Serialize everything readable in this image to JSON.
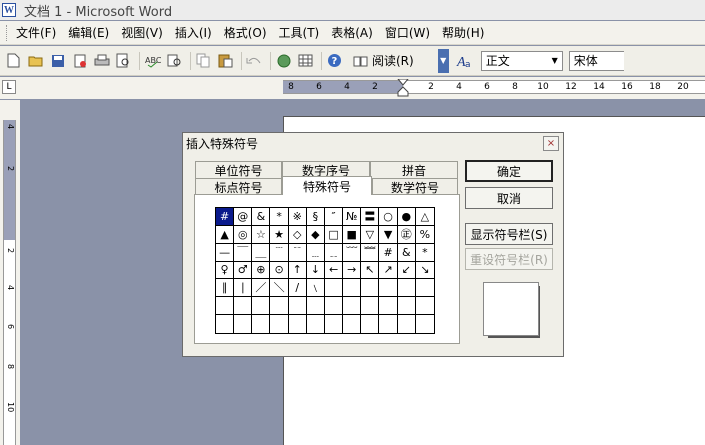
{
  "window": {
    "title": "文档 1 - Microsoft Word",
    "app_icon": "W"
  },
  "menu": [
    {
      "label": "文件(F)"
    },
    {
      "label": "编辑(E)"
    },
    {
      "label": "视图(V)"
    },
    {
      "label": "插入(I)"
    },
    {
      "label": "格式(O)"
    },
    {
      "label": "工具(T)"
    },
    {
      "label": "表格(A)"
    },
    {
      "label": "窗口(W)"
    },
    {
      "label": "帮助(H)"
    }
  ],
  "toolbar": {
    "read_label": "阅读(R)",
    "style_value": "正文",
    "font_value": "宋体",
    "icons": [
      "new-icon",
      "open-icon",
      "save-icon",
      "permission-icon",
      "print-preview-icon",
      "print-icon",
      "spelling-icon",
      "research-icon",
      "copy-icon",
      "paste-icon",
      "undo-icon",
      "hyperlink-icon",
      "table-icon",
      "help-icon"
    ]
  },
  "ruler": {
    "corner_glyph": "L",
    "h_ticks": [
      "8",
      "6",
      "4",
      "2",
      "2",
      "4",
      "6",
      "8",
      "10",
      "12",
      "14",
      "16",
      "18",
      "20"
    ],
    "v_ticks": [
      "4",
      "2",
      "2",
      "4",
      "6",
      "8",
      "10"
    ]
  },
  "dialog": {
    "title": "插入特殊符号",
    "close_glyph": "×",
    "tabs_back": [
      "单位符号",
      "数字序号",
      "拼音"
    ],
    "tabs_front": [
      "标点符号",
      "特殊符号",
      "数学符号"
    ],
    "active_tab": "特殊符号",
    "symbols": [
      [
        "#",
        "@",
        "&",
        "*",
        "※",
        "§",
        "″",
        "№",
        "〓",
        "○",
        "●",
        "△"
      ],
      [
        "▲",
        "◎",
        "☆",
        "★",
        "◇",
        "◆",
        "□",
        "■",
        "▽",
        "▼",
        "㊣",
        "%"
      ],
      [
        "—",
        "￣",
        "＿",
        "﹉",
        "﹊",
        "﹍",
        "﹎",
        "﹋",
        "﹌",
        "#",
        "&",
        "*"
      ],
      [
        "♀",
        "♂",
        "⊕",
        "⊙",
        "↑",
        "↓",
        "←",
        "→",
        "↖",
        "↗",
        "↙",
        "↘"
      ],
      [
        "∥",
        "∣",
        "／",
        "＼",
        "∕",
        "﹨",
        "",
        "",
        "",
        "",
        "",
        ""
      ],
      [
        "",
        "",
        "",
        "",
        "",
        "",
        "",
        "",
        "",
        "",
        "",
        ""
      ],
      [
        "",
        "",
        "",
        "",
        "",
        "",
        "",
        "",
        "",
        "",
        "",
        ""
      ]
    ],
    "selected_symbol": "#",
    "buttons": {
      "ok": "确定",
      "cancel": "取消",
      "show_bar": "显示符号栏(S)",
      "reset_bar": "重设符号栏(R)"
    }
  }
}
